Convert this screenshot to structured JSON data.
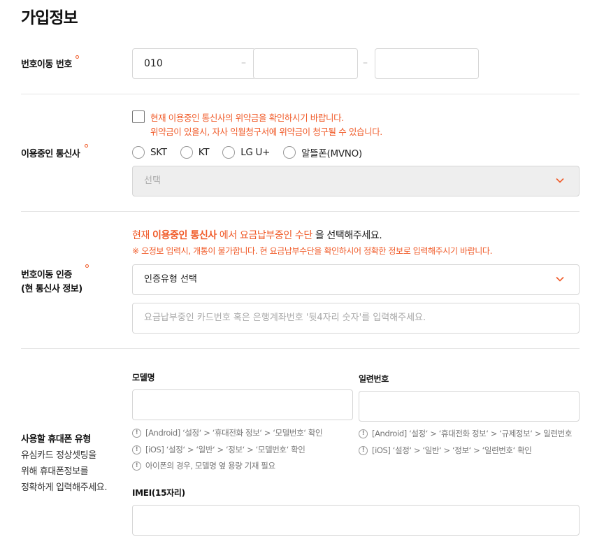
{
  "page_title": "가입정보",
  "port_number": {
    "label": "번호이동 번호",
    "part1": "010",
    "part2": "",
    "part3": "",
    "separator": "–"
  },
  "current_carrier": {
    "label": "이용중인 통신사",
    "confirm_text_line1": "현재 이용중인 통신사의 위약금을 확인하시기 바랍니다.",
    "confirm_text_line2": "위약금이 있을시, 자사 익월청구서에 위약금이 청구될 수 있습니다.",
    "options": [
      "SKT",
      "KT",
      "LG U+",
      "알뜰폰(MVNO)"
    ],
    "select_placeholder": "선택"
  },
  "verification": {
    "label_line1": "번호이동 인증",
    "label_line2": "(현 통신사 정보)",
    "headline_prefix": "현재 ",
    "headline_bold": "이용중인 통신사",
    "headline_mid": " 에서 요금납부중인 수단",
    "headline_suffix": " 을 선택해주세요.",
    "warning": "※ 오정보 입력시, 개통이 불가합니다. 현 요금납부수단을 확인하시어 정확한 정보로 입력해주시기 바랍니다.",
    "type_select": "인증유형 선택",
    "number_placeholder": "요금납부중인 카드번호 혹은 은행계좌번호 '뒷4자리 숫자'를 입력해주세요."
  },
  "device": {
    "label": "사용할 휴대폰 유형",
    "desc_line1": "유심카드 정상셋팅을",
    "desc_line2": "위해 휴대폰정보를",
    "desc_line3": "정확하게 입력해주세요.",
    "model_label": "모델명",
    "serial_label": "일련번호",
    "model_value": "",
    "serial_value": "",
    "model_notes": [
      "[Android] ‘설정‘ > ‘휴대전화 정보‘ > ‘모델번호‘ 확인",
      "[iOS] ‘설정‘ > ‘일반‘ > ‘정보‘ > ‘모델번호‘ 확인",
      "아이폰의 경우, 모델명 옆 용량 기재 필요"
    ],
    "serial_notes": [
      "[Android] ‘설정‘ > ‘휴대전화 정보‘ > ‘규제정보‘ > 일련번호",
      "[iOS] ‘설정‘ > ‘일반‘ > ‘정보‘ > ‘일련번호‘ 확인"
    ],
    "imei_label": "IMEI(15자리)",
    "imei_value": "",
    "info_icon_glyph": "!"
  },
  "colors": {
    "accent": "#f05a28",
    "border": "#d6d6d6",
    "disabled_bg": "#eeeeee"
  }
}
